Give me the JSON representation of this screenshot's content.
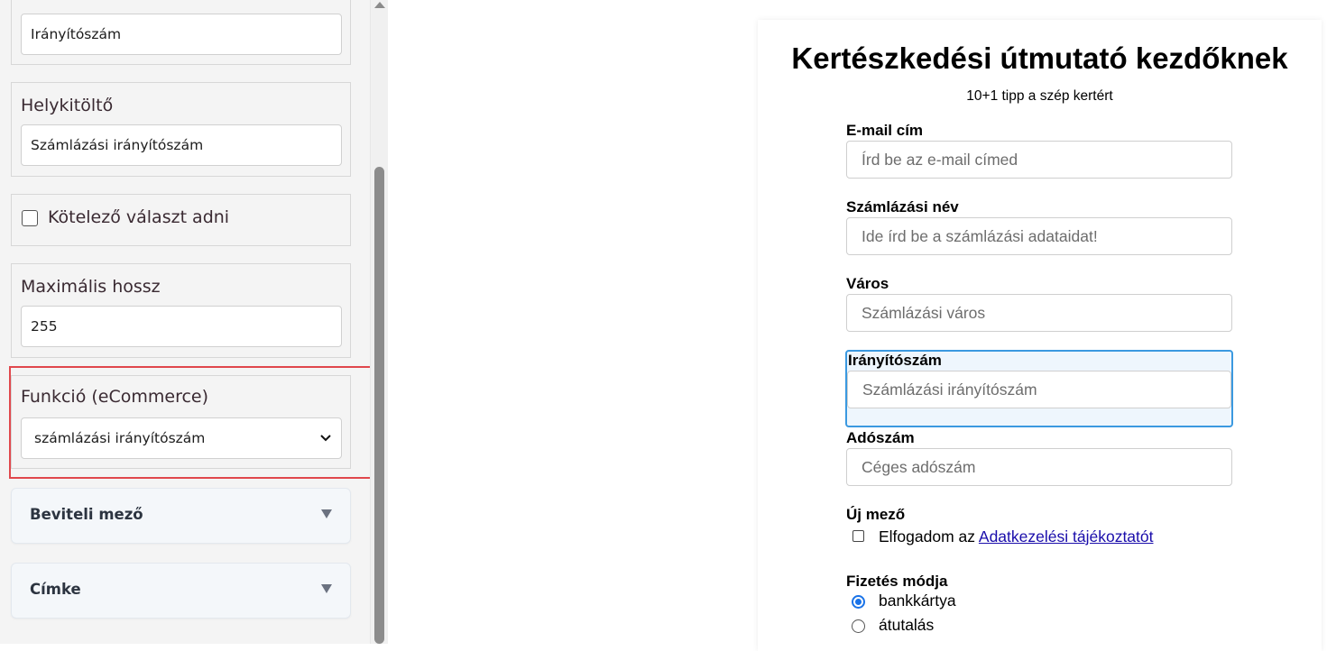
{
  "sidebar": {
    "top_field_value": "Irányítószám",
    "placeholder_panel": {
      "label": "Helykitöltő",
      "value": "Számlázási irányítószám"
    },
    "required_panel": {
      "label": "Kötelező választ adni",
      "checked": false
    },
    "maxlength_panel": {
      "label": "Maximális hossz",
      "value": "255"
    },
    "function_panel": {
      "label": "Funkció (eCommerce)",
      "selected": "számlázási irányítószám"
    },
    "accordions": [
      {
        "label": "Beviteli mező"
      },
      {
        "label": "Címke"
      }
    ]
  },
  "form": {
    "title": "Kertészkedési útmutató kezdőknek",
    "subtitle": "10+1 tipp a szép kertért",
    "fields": [
      {
        "label": "E-mail cím",
        "placeholder": "Írd be az e-mail címed"
      },
      {
        "label": "Számlázási név",
        "placeholder": "Ide írd be a számlázási adataidat!"
      },
      {
        "label": "Város",
        "placeholder": "Számlázási város"
      },
      {
        "label": "Irányítószám",
        "placeholder": "Számlázási irányítószám"
      },
      {
        "label": "Adószám",
        "placeholder": "Céges adószám"
      }
    ],
    "new_field": {
      "label": "Új mező",
      "consent_prefix": "Elfogadom az ",
      "consent_link": "Adatkezelési tájékoztatót"
    },
    "payment": {
      "label": "Fizetés módja",
      "options": [
        {
          "label": "bankkártya",
          "selected": true
        },
        {
          "label": "átutalás",
          "selected": false
        }
      ]
    }
  },
  "colors": {
    "highlight": "#e0474c",
    "focus": "#3b99e0",
    "radio_accent": "#1a73e8",
    "link": "#1a0dab"
  }
}
